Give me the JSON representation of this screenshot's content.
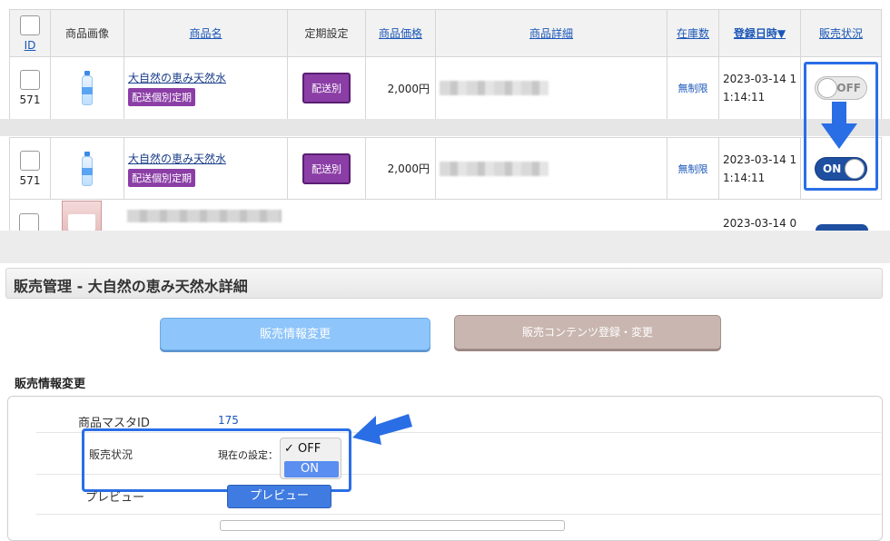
{
  "table": {
    "headers": {
      "id": "ID",
      "image": "商品画像",
      "name": "商品名",
      "recurring": "定期設定",
      "price": "商品価格",
      "detail": "商品詳細",
      "stock": "在庫数",
      "date": "登録日時▼",
      "status": "販売状況"
    },
    "rows": [
      {
        "id": "571",
        "name": "大自然の恵み天然水",
        "tag": "配送個別定期",
        "ship": "配送別",
        "price": "2,000円",
        "stock": "無制限",
        "date1": "2023-03-14 1",
        "date2": "1:14:11",
        "toggle": "OFF"
      },
      {
        "id": "571",
        "name": "大自然の恵み天然水",
        "tag": "配送個別定期",
        "ship": "配送別",
        "price": "2,000円",
        "stock": "無制限",
        "date1": "2023-03-14 1",
        "date2": "1:14:11",
        "toggle": "ON"
      }
    ],
    "partial_date": "2023-03-14 0"
  },
  "section": {
    "title": "販売管理 - 大自然の恵み天然水詳細",
    "tab_active": "販売情報変更",
    "tab_other": "販売コンテンツ登録・変更",
    "subheading": "販売情報変更"
  },
  "form": {
    "master_id_label": "商品マスタID",
    "master_id_value": "175",
    "status_label": "販売状況",
    "current_setting": "現在の設定：",
    "options": [
      "✓ OFF",
      "ON"
    ],
    "preview_label": "プレビュー",
    "preview_button": "プレビュー"
  },
  "colors": {
    "highlight": "#2a6ee6",
    "purple_tag": "#8b3ea6",
    "toggle_on": "#1e4fa0"
  }
}
